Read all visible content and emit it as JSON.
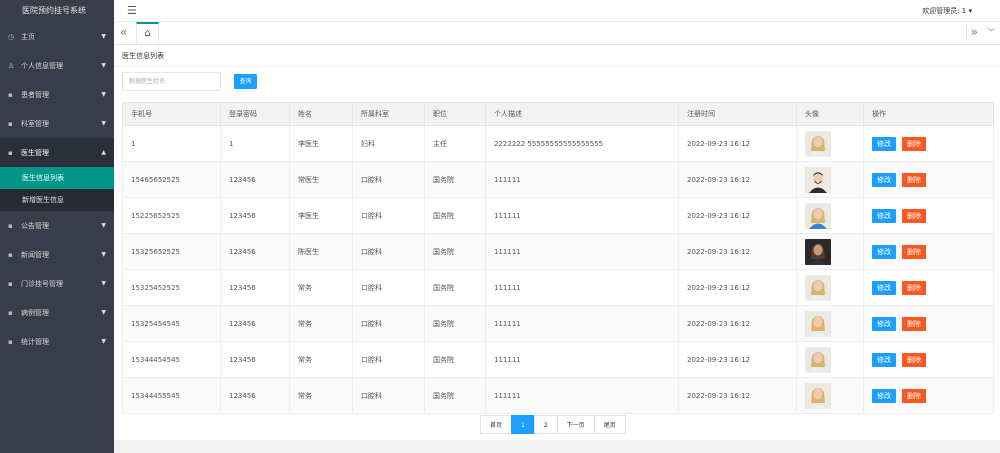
{
  "app": {
    "title": "医院预约挂号系统"
  },
  "header": {
    "menu_icon": "menu-icon",
    "user_label": "欢迎管理员: 1",
    "user_caret": "▾"
  },
  "sidebar": {
    "items": [
      {
        "icon": "◷",
        "label": "主页"
      },
      {
        "icon": "♙",
        "label": "个人信息管理"
      },
      {
        "icon": "",
        "label": "患者管理"
      },
      {
        "icon": "",
        "label": "科室管理"
      },
      {
        "icon": "",
        "label": "医生管理",
        "open": true,
        "subitems": [
          "医生信息列表",
          "新增医生信息"
        ]
      },
      {
        "icon": "",
        "label": "公告管理"
      },
      {
        "icon": "",
        "label": "新闻管理"
      },
      {
        "icon": "",
        "label": "门诊挂号管理"
      },
      {
        "icon": "",
        "label": "病例管理"
      },
      {
        "icon": "",
        "label": "统计管理"
      }
    ]
  },
  "tabs": {
    "left_arrow": "«",
    "home_icon": "⌂",
    "right_arrow": "»",
    "down_arrow": "﹀"
  },
  "page": {
    "title": "医生信息列表",
    "search_placeholder": "根据医生姓名",
    "search_button": "查询"
  },
  "table": {
    "headers": [
      "手机号",
      "登录密码",
      "姓名",
      "所属科室",
      "职位",
      "个人描述",
      "注册时间",
      "头像",
      "操作"
    ],
    "rows": [
      {
        "phone": "1",
        "password": "1",
        "name": "李医生",
        "dept": "妇科",
        "position": "主任",
        "desc": "2222222 55555555555555555",
        "time": "2022-09-23 16:12",
        "avatar": "blonde"
      },
      {
        "phone": "15465652525",
        "password": "123456",
        "name": "常医生",
        "dept": "口腔科",
        "position": "国务院",
        "desc": "111111",
        "time": "2022-09-23 16:12",
        "avatar": "man"
      },
      {
        "phone": "15225652525",
        "password": "123456",
        "name": "李医生",
        "dept": "口腔科",
        "position": "国务院",
        "desc": "111111",
        "time": "2022-09-23 16:12",
        "avatar": "blonde-blue"
      },
      {
        "phone": "15325652525",
        "password": "123456",
        "name": "陈医生",
        "dept": "口腔科",
        "position": "国务院",
        "desc": "111111",
        "time": "2022-09-23 16:12",
        "avatar": "dark"
      },
      {
        "phone": "15325452525",
        "password": "123456",
        "name": "常务",
        "dept": "口腔科",
        "position": "国务院",
        "desc": "111111",
        "time": "2022-09-23 16:12",
        "avatar": "blonde"
      },
      {
        "phone": "15325454545",
        "password": "123456",
        "name": "常务",
        "dept": "口腔科",
        "position": "国务院",
        "desc": "111111",
        "time": "2022-09-23 16:12",
        "avatar": "blonde"
      },
      {
        "phone": "15344454545",
        "password": "123456",
        "name": "常务",
        "dept": "口腔科",
        "position": "国务院",
        "desc": "111111",
        "time": "2022-09-23 16:12",
        "avatar": "blonde"
      },
      {
        "phone": "15344455545",
        "password": "123456",
        "name": "常务",
        "dept": "口腔科",
        "position": "国务院",
        "desc": "111111",
        "time": "2022-09-23 16:12",
        "avatar": "blonde"
      }
    ],
    "edit_label": "修改",
    "delete_label": "删除"
  },
  "pager": {
    "first": "首页",
    "pages": [
      "1",
      "2"
    ],
    "current": "1",
    "next": "下一页",
    "last": "尾页"
  },
  "colors": {
    "sidebar": "#393d49",
    "active": "#009688",
    "primary": "#1e9fff",
    "danger": "#ff5722"
  }
}
